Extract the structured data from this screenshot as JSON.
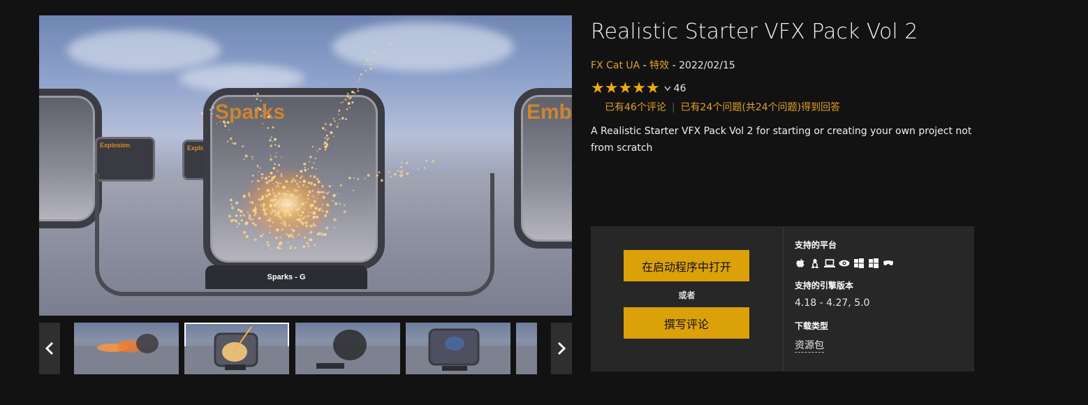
{
  "product": {
    "title": "Realistic Starter VFX Pack Vol 2",
    "seller": "FX Cat UA",
    "category": "特效",
    "separator": " - ",
    "date": "2022/02/15",
    "rating_value": 5,
    "rating_count": "46",
    "review_count_link": "已有46个评论",
    "questions_link": "已有24个问题(共24个问题)得到回答",
    "description": "A Realistic Starter VFX Pack Vol 2 for starting or creating your own project not from scratch"
  },
  "media": {
    "hero_labels": {
      "sparks": "Sparks",
      "embers": "Emb",
      "explosion1": "Explosion",
      "explosion2": "Explo",
      "plate": "Sparks - G"
    },
    "prev_icon": "chevron-left-icon",
    "next_icon": "chevron-right-icon",
    "active_thumb_index": 1,
    "thumb_count": 5
  },
  "actions": {
    "open_label": "在启动程序中打开",
    "or_label": "或者",
    "review_label": "撰写评论"
  },
  "info": {
    "platforms_heading": "支持的平台",
    "platform_icons": [
      "apple-icon",
      "linux-icon",
      "laptop-icon",
      "eye-icon",
      "windows-icon",
      "windows-icon",
      "vr-headset-icon"
    ],
    "engine_heading": "支持的引擎版本",
    "engine_versions": "4.18 - 4.27, 5.0",
    "download_heading": "下载类型",
    "download_type": "资源包"
  },
  "colors": {
    "background": "#121212",
    "accent": "#e3a11d",
    "button": "#dba108",
    "panel": "#272727"
  }
}
